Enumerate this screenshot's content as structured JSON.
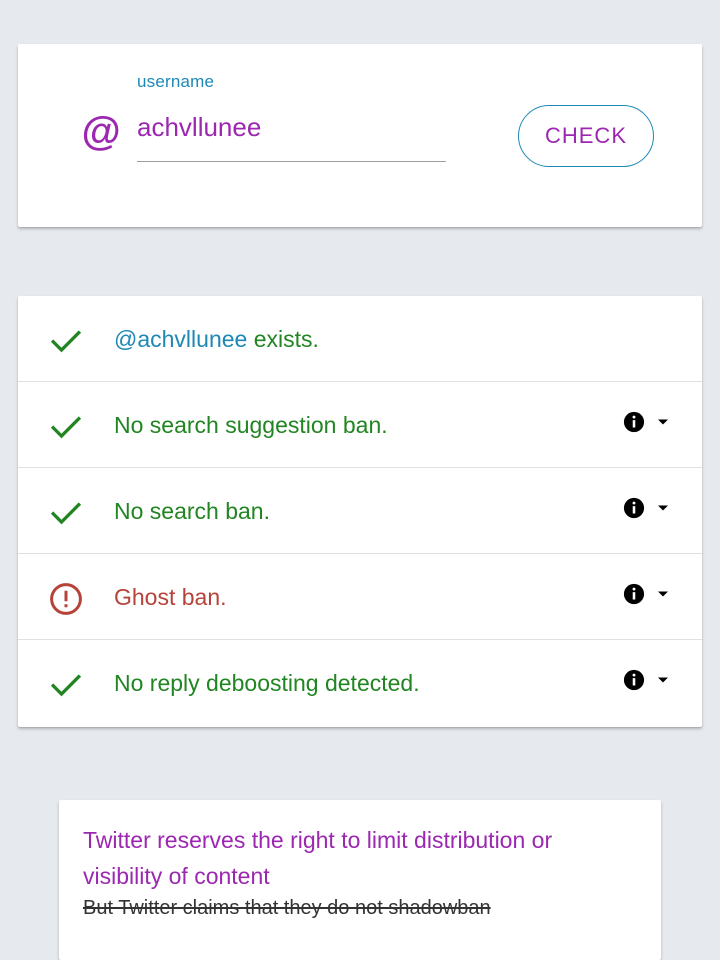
{
  "search": {
    "at_symbol": "@",
    "label": "username",
    "value": "achvllunee",
    "button_label": "CHECK"
  },
  "results": [
    {
      "status": "ok",
      "icon": "check-icon",
      "handle": "@achvllunee",
      "text": " exists.",
      "has_controls": false
    },
    {
      "status": "ok",
      "icon": "check-icon",
      "handle": "",
      "text": "No search suggestion ban.",
      "has_controls": true
    },
    {
      "status": "ok",
      "icon": "check-icon",
      "handle": "",
      "text": "No search ban.",
      "has_controls": true
    },
    {
      "status": "bad",
      "icon": "alert-circle-icon",
      "handle": "",
      "text": "Ghost ban.",
      "has_controls": true
    },
    {
      "status": "ok",
      "icon": "check-icon",
      "handle": "",
      "text": "No reply deboosting detected.",
      "has_controls": true
    }
  ],
  "info": {
    "heading": "Twitter reserves the right to limit distribution or visibility of content",
    "strikethrough": "But Twitter claims that they do not shadowban"
  },
  "colors": {
    "accent_purple": "#9c27b0",
    "accent_blue": "#1e88b5",
    "ok_green": "#218521",
    "error_red": "#b5433a",
    "background": "#e6eaee"
  }
}
